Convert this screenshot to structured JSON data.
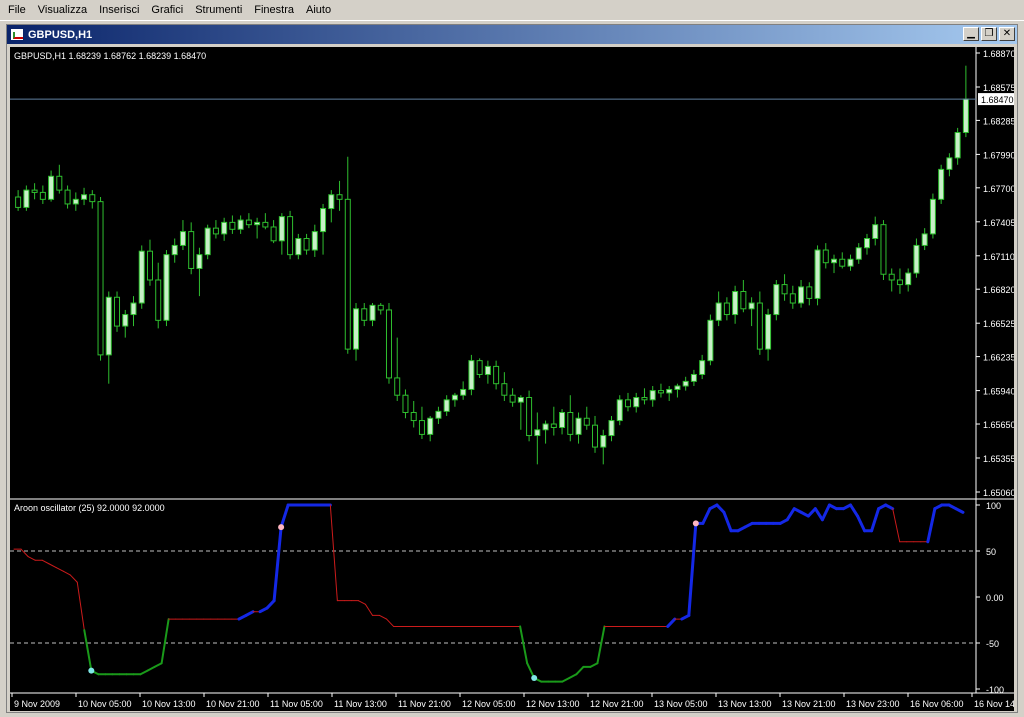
{
  "menu": {
    "items": [
      "File",
      "Visualizza",
      "Inserisci",
      "Grafici",
      "Strumenti",
      "Finestra",
      "Aiuto"
    ]
  },
  "window": {
    "title": "GBPUSD,H1",
    "buttons": [
      "minimize",
      "restore",
      "close"
    ]
  },
  "chart_data": [
    {
      "type": "candlestick",
      "header": "GBPUSD,H1  1.68239 1.68762 1.68239 1.68470",
      "price_axis_labels": [
        "1.68870",
        "1.68575",
        "1.68285",
        "1.67990",
        "1.67700",
        "1.67405",
        "1.67110",
        "1.66820",
        "1.66525",
        "1.66235",
        "1.65940",
        "1.65650",
        "1.65355",
        "1.65060"
      ],
      "current_price_label": "1.68470",
      "ylim": [
        1.6506,
        1.6887
      ],
      "colors": {
        "bull": "#c8f0c8",
        "bear": "#000000",
        "wick": "#2fbf2f",
        "price_line": "#5f7f9f"
      },
      "candles": [
        [
          1.6762,
          1.6768,
          1.675,
          1.6753
        ],
        [
          1.6753,
          1.6772,
          1.675,
          1.6768
        ],
        [
          1.6768,
          1.6774,
          1.676,
          1.6766
        ],
        [
          1.6766,
          1.6772,
          1.6756,
          1.676
        ],
        [
          1.676,
          1.6785,
          1.6758,
          1.678
        ],
        [
          1.678,
          1.679,
          1.6765,
          1.6768
        ],
        [
          1.6768,
          1.6772,
          1.6752,
          1.6756
        ],
        [
          1.6756,
          1.6766,
          1.675,
          1.676
        ],
        [
          1.676,
          1.677,
          1.6755,
          1.6764
        ],
        [
          1.6764,
          1.6768,
          1.6752,
          1.6758
        ],
        [
          1.6758,
          1.6762,
          1.662,
          1.6625
        ],
        [
          1.6625,
          1.668,
          1.66,
          1.6675
        ],
        [
          1.6675,
          1.668,
          1.6645,
          1.665
        ],
        [
          1.665,
          1.6664,
          1.664,
          1.666
        ],
        [
          1.666,
          1.6676,
          1.665,
          1.667
        ],
        [
          1.667,
          1.672,
          1.6665,
          1.6715
        ],
        [
          1.6715,
          1.6725,
          1.6685,
          1.669
        ],
        [
          1.669,
          1.6705,
          1.6648,
          1.6655
        ],
        [
          1.6655,
          1.6716,
          1.665,
          1.6712
        ],
        [
          1.6712,
          1.6726,
          1.6705,
          1.672
        ],
        [
          1.672,
          1.6742,
          1.6716,
          1.6732
        ],
        [
          1.6732,
          1.674,
          1.6695,
          1.67
        ],
        [
          1.67,
          1.6718,
          1.6676,
          1.6712
        ],
        [
          1.6712,
          1.6738,
          1.6708,
          1.6735
        ],
        [
          1.6735,
          1.6742,
          1.6726,
          1.673
        ],
        [
          1.673,
          1.6744,
          1.6724,
          1.674
        ],
        [
          1.674,
          1.6746,
          1.673,
          1.6734
        ],
        [
          1.6734,
          1.6746,
          1.673,
          1.6742
        ],
        [
          1.6742,
          1.6748,
          1.6735,
          1.6738
        ],
        [
          1.6738,
          1.6744,
          1.6726,
          1.674
        ],
        [
          1.674,
          1.6748,
          1.6734,
          1.6736
        ],
        [
          1.6736,
          1.6742,
          1.6722,
          1.6724
        ],
        [
          1.6724,
          1.6748,
          1.6712,
          1.6745
        ],
        [
          1.6745,
          1.675,
          1.6708,
          1.6712
        ],
        [
          1.6712,
          1.673,
          1.6708,
          1.6726
        ],
        [
          1.6726,
          1.673,
          1.6712,
          1.6716
        ],
        [
          1.6716,
          1.6738,
          1.671,
          1.6732
        ],
        [
          1.6732,
          1.6756,
          1.6712,
          1.6752
        ],
        [
          1.6752,
          1.6768,
          1.674,
          1.6764
        ],
        [
          1.6764,
          1.6776,
          1.675,
          1.676
        ],
        [
          1.676,
          1.6797,
          1.6626,
          1.663
        ],
        [
          1.663,
          1.667,
          1.662,
          1.6665
        ],
        [
          1.6665,
          1.667,
          1.665,
          1.6655
        ],
        [
          1.6655,
          1.667,
          1.665,
          1.6668
        ],
        [
          1.6668,
          1.667,
          1.666,
          1.6664
        ],
        [
          1.6664,
          1.667,
          1.66,
          1.6605
        ],
        [
          1.6605,
          1.664,
          1.6585,
          1.659
        ],
        [
          1.659,
          1.6595,
          1.657,
          1.6575
        ],
        [
          1.6575,
          1.6585,
          1.6562,
          1.6568
        ],
        [
          1.6568,
          1.658,
          1.6552,
          1.6556
        ],
        [
          1.6556,
          1.6572,
          1.655,
          1.657
        ],
        [
          1.657,
          1.658,
          1.6565,
          1.6576
        ],
        [
          1.6576,
          1.659,
          1.6572,
          1.6586
        ],
        [
          1.6586,
          1.6592,
          1.658,
          1.659
        ],
        [
          1.659,
          1.6602,
          1.6586,
          1.6595
        ],
        [
          1.6595,
          1.6625,
          1.659,
          1.662
        ],
        [
          1.662,
          1.6622,
          1.6605,
          1.6608
        ],
        [
          1.6608,
          1.662,
          1.66,
          1.6615
        ],
        [
          1.6615,
          1.662,
          1.6595,
          1.66
        ],
        [
          1.66,
          1.661,
          1.6585,
          1.659
        ],
        [
          1.659,
          1.6596,
          1.658,
          1.6584
        ],
        [
          1.6584,
          1.659,
          1.656,
          1.6588
        ],
        [
          1.6588,
          1.6594,
          1.655,
          1.6555
        ],
        [
          1.6555,
          1.6575,
          1.653,
          1.656
        ],
        [
          1.656,
          1.6568,
          1.6548,
          1.6565
        ],
        [
          1.6565,
          1.658,
          1.6555,
          1.6562
        ],
        [
          1.6562,
          1.6578,
          1.6556,
          1.6575
        ],
        [
          1.6575,
          1.659,
          1.655,
          1.6556
        ],
        [
          1.6556,
          1.6575,
          1.6548,
          1.657
        ],
        [
          1.657,
          1.658,
          1.656,
          1.6564
        ],
        [
          1.6564,
          1.6572,
          1.654,
          1.6545
        ],
        [
          1.6545,
          1.656,
          1.653,
          1.6555
        ],
        [
          1.6555,
          1.6572,
          1.655,
          1.6568
        ],
        [
          1.6568,
          1.659,
          1.6564,
          1.6586
        ],
        [
          1.6586,
          1.6592,
          1.6576,
          1.658
        ],
        [
          1.658,
          1.6592,
          1.6575,
          1.6588
        ],
        [
          1.6588,
          1.6596,
          1.6582,
          1.6586
        ],
        [
          1.6586,
          1.6598,
          1.658,
          1.6594
        ],
        [
          1.6594,
          1.66,
          1.6588,
          1.6592
        ],
        [
          1.6592,
          1.6598,
          1.6585,
          1.6595
        ],
        [
          1.6595,
          1.66,
          1.6588,
          1.6598
        ],
        [
          1.6598,
          1.6606,
          1.6594,
          1.6602
        ],
        [
          1.6602,
          1.6612,
          1.6598,
          1.6608
        ],
        [
          1.6608,
          1.6625,
          1.6604,
          1.662
        ],
        [
          1.662,
          1.666,
          1.6616,
          1.6655
        ],
        [
          1.6655,
          1.668,
          1.665,
          1.667
        ],
        [
          1.667,
          1.6675,
          1.6655,
          1.666
        ],
        [
          1.666,
          1.6685,
          1.6652,
          1.668
        ],
        [
          1.668,
          1.669,
          1.6662,
          1.6665
        ],
        [
          1.6665,
          1.6675,
          1.665,
          1.667
        ],
        [
          1.667,
          1.668,
          1.6625,
          1.663
        ],
        [
          1.663,
          1.6665,
          1.662,
          1.666
        ],
        [
          1.666,
          1.669,
          1.6655,
          1.6686
        ],
        [
          1.6686,
          1.6695,
          1.6672,
          1.6678
        ],
        [
          1.6678,
          1.6685,
          1.6665,
          1.667
        ],
        [
          1.667,
          1.669,
          1.6666,
          1.6684
        ],
        [
          1.6684,
          1.6688,
          1.6668,
          1.6674
        ],
        [
          1.6674,
          1.672,
          1.6668,
          1.6716
        ],
        [
          1.6716,
          1.6722,
          1.67,
          1.6705
        ],
        [
          1.6705,
          1.6712,
          1.6696,
          1.6708
        ],
        [
          1.6708,
          1.6714,
          1.67,
          1.6702
        ],
        [
          1.6702,
          1.6712,
          1.6698,
          1.6708
        ],
        [
          1.6708,
          1.6722,
          1.6704,
          1.6718
        ],
        [
          1.6718,
          1.673,
          1.6712,
          1.6726
        ],
        [
          1.6726,
          1.6745,
          1.672,
          1.6738
        ],
        [
          1.6738,
          1.6742,
          1.669,
          1.6695
        ],
        [
          1.6695,
          1.67,
          1.668,
          1.669
        ],
        [
          1.669,
          1.67,
          1.6678,
          1.6686
        ],
        [
          1.6686,
          1.67,
          1.668,
          1.6696
        ],
        [
          1.6696,
          1.6726,
          1.6692,
          1.672
        ],
        [
          1.672,
          1.6735,
          1.6716,
          1.673
        ],
        [
          1.673,
          1.6765,
          1.6726,
          1.676
        ],
        [
          1.676,
          1.679,
          1.6756,
          1.6786
        ],
        [
          1.6786,
          1.68,
          1.678,
          1.6796
        ],
        [
          1.6796,
          1.6822,
          1.679,
          1.6818
        ],
        [
          1.6818,
          1.6876,
          1.6814,
          1.6847
        ]
      ]
    },
    {
      "type": "line",
      "header": "Aroon oscillator (25) 92.0000 92.0000",
      "axis_labels": [
        "100",
        "50",
        "0.00",
        "-50",
        "-100"
      ],
      "ylim": [
        -100,
        100
      ],
      "levels": [
        50,
        -50
      ],
      "colors": {
        "down": "#cc1b1b",
        "up": "#1428e6",
        "extreme_low": "#1a9a1a",
        "dot_low": "#7fe7e7",
        "dot_high": "#ffb6c1"
      },
      "values": [
        52,
        52,
        44,
        40,
        40,
        36,
        32,
        28,
        24,
        16,
        -36,
        -80,
        -84,
        -84,
        -84,
        -84,
        -84,
        -84,
        -84,
        -80,
        -76,
        -72,
        -24,
        -24,
        -24,
        -24,
        -24,
        -24,
        -24,
        -24,
        -24,
        -24,
        -24,
        -20,
        -16,
        -16,
        -12,
        -4,
        76,
        100,
        100,
        100,
        100,
        100,
        100,
        100,
        -4,
        -4,
        -4,
        -4,
        -8,
        -20,
        -20,
        -24,
        -32,
        -32,
        -32,
        -32,
        -32,
        -32,
        -32,
        -32,
        -32,
        -32,
        -32,
        -32,
        -32,
        -32,
        -32,
        -32,
        -32,
        -32,
        -32,
        -72,
        -88,
        -92,
        -92,
        -92,
        -92,
        -88,
        -84,
        -76,
        -76,
        -72,
        -32,
        -32,
        -32,
        -32,
        -32,
        -32,
        -32,
        -32,
        -32,
        -32,
        -24,
        -24,
        -20,
        80,
        80,
        96,
        100,
        92,
        72,
        72,
        76,
        80,
        80,
        80,
        80,
        80,
        84,
        96,
        92,
        88,
        96,
        84,
        100,
        96,
        96,
        100,
        88,
        72,
        72,
        96,
        100,
        96,
        60,
        60,
        60,
        60,
        60,
        96,
        100,
        100,
        96,
        92
      ],
      "markers": [
        {
          "index": 11,
          "value": -80,
          "kind": "low"
        },
        {
          "index": 38,
          "value": 76,
          "kind": "high"
        },
        {
          "index": 74,
          "value": -88,
          "kind": "low"
        },
        {
          "index": 97,
          "value": 80,
          "kind": "high"
        }
      ]
    }
  ],
  "time_axis": {
    "labels": [
      "9 Nov 2009",
      "10 Nov 05:00",
      "10 Nov 13:00",
      "10 Nov 21:00",
      "11 Nov 05:00",
      "11 Nov 13:00",
      "11 Nov 21:00",
      "12 Nov 05:00",
      "12 Nov 13:00",
      "12 Nov 21:00",
      "13 Nov 05:00",
      "13 Nov 13:00",
      "13 Nov 21:00",
      "13 Nov 23:00",
      "16 Nov 06:00",
      "16 Nov 14:00"
    ]
  }
}
